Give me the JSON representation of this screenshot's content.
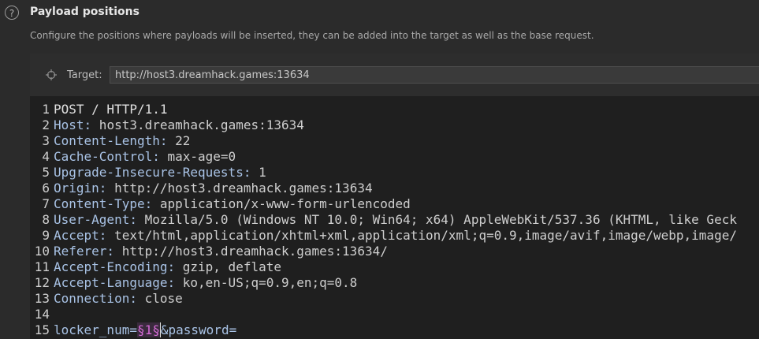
{
  "header": {
    "title": "Payload positions",
    "description": "Configure the positions where payloads will be inserted, they can be added into the target as well as the base request."
  },
  "target": {
    "label": "Target:",
    "value": "http://host3.dreamhack.games:13634"
  },
  "request_lines": [
    {
      "num": "1",
      "key": "POST / HTTP/1.1",
      "val": ""
    },
    {
      "num": "2",
      "key": "Host:",
      "val": " host3.dreamhack.games:13634"
    },
    {
      "num": "3",
      "key": "Content-Length:",
      "val": " 22"
    },
    {
      "num": "4",
      "key": "Cache-Control:",
      "val": " max-age=0"
    },
    {
      "num": "5",
      "key": "Upgrade-Insecure-Requests:",
      "val": " 1"
    },
    {
      "num": "6",
      "key": "Origin:",
      "val": " http://host3.dreamhack.games:13634"
    },
    {
      "num": "7",
      "key": "Content-Type:",
      "val": " application/x-www-form-urlencoded"
    },
    {
      "num": "8",
      "key": "User-Agent:",
      "val": " Mozilla/5.0 (Windows NT 10.0; Win64; x64) AppleWebKit/537.36 (KHTML, like Geck"
    },
    {
      "num": "9",
      "key": "Accept:",
      "val": " text/html,application/xhtml+xml,application/xml;q=0.9,image/avif,image/webp,image/"
    },
    {
      "num": "10",
      "key": "Referer:",
      "val": " http://host3.dreamhack.games:13634/"
    },
    {
      "num": "11",
      "key": "Accept-Encoding:",
      "val": " gzip, deflate"
    },
    {
      "num": "12",
      "key": "Accept-Language:",
      "val": " ko,en-US;q=0.9,en;q=0.8"
    },
    {
      "num": "13",
      "key": "Connection:",
      "val": " close"
    },
    {
      "num": "14",
      "key": "",
      "val": ""
    }
  ],
  "body_line": {
    "num": "15",
    "param1": "locker_num=",
    "payload": "§1§",
    "param2": "&password="
  },
  "colors": {
    "background": "#2b2b2b",
    "key": "#a9c3e6",
    "payload": "#d56bd6"
  }
}
